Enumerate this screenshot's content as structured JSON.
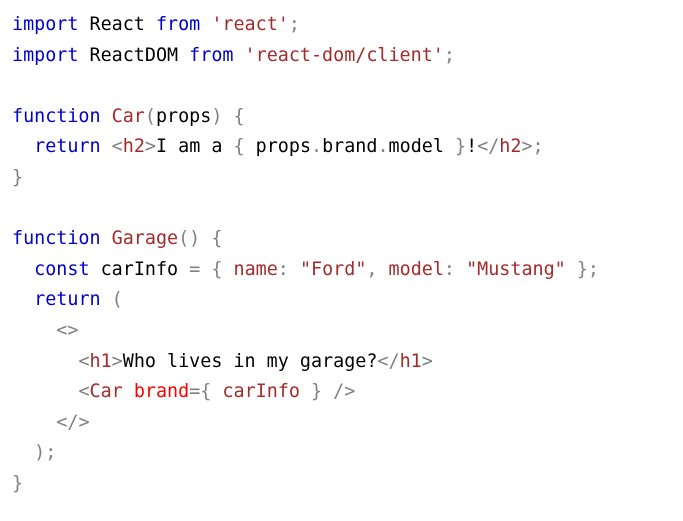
{
  "colors": {
    "keyword": "#0000cd",
    "string": "#a52a2a",
    "function_name": "#a52a2a",
    "punctuation": "#808080",
    "tag": "#a52a2a",
    "attribute": "#ff0000",
    "text": "#000000",
    "background": "#ffffff"
  },
  "code_lines": [
    [
      {
        "t": "import",
        "c": "kw"
      },
      {
        "t": " React ",
        "c": "plain"
      },
      {
        "t": "from",
        "c": "kw"
      },
      {
        "t": " ",
        "c": "plain"
      },
      {
        "t": "'react'",
        "c": "str"
      },
      {
        "t": ";",
        "c": "punct"
      }
    ],
    [
      {
        "t": "import",
        "c": "kw"
      },
      {
        "t": " ReactDOM ",
        "c": "plain"
      },
      {
        "t": "from",
        "c": "kw"
      },
      {
        "t": " ",
        "c": "plain"
      },
      {
        "t": "'react-dom/client'",
        "c": "str"
      },
      {
        "t": ";",
        "c": "punct"
      }
    ],
    [],
    [
      {
        "t": "function",
        "c": "kw"
      },
      {
        "t": " ",
        "c": "plain"
      },
      {
        "t": "Car",
        "c": "fn"
      },
      {
        "t": "(",
        "c": "punct"
      },
      {
        "t": "props",
        "c": "plain"
      },
      {
        "t": ")",
        "c": "punct"
      },
      {
        "t": " ",
        "c": "plain"
      },
      {
        "t": "{",
        "c": "punct"
      }
    ],
    [
      {
        "t": "  ",
        "c": "plain"
      },
      {
        "t": "return",
        "c": "kw"
      },
      {
        "t": " ",
        "c": "plain"
      },
      {
        "t": "<",
        "c": "punct"
      },
      {
        "t": "h2",
        "c": "tag"
      },
      {
        "t": ">",
        "c": "punct"
      },
      {
        "t": "I am a ",
        "c": "plain"
      },
      {
        "t": "{",
        "c": "punct"
      },
      {
        "t": " props",
        "c": "plain"
      },
      {
        "t": ".",
        "c": "punct"
      },
      {
        "t": "brand",
        "c": "plain"
      },
      {
        "t": ".",
        "c": "punct"
      },
      {
        "t": "model ",
        "c": "plain"
      },
      {
        "t": "}",
        "c": "punct"
      },
      {
        "t": "!",
        "c": "plain"
      },
      {
        "t": "</",
        "c": "punct"
      },
      {
        "t": "h2",
        "c": "tag"
      },
      {
        "t": ">",
        "c": "punct"
      },
      {
        "t": ";",
        "c": "punct"
      }
    ],
    [
      {
        "t": "}",
        "c": "punct"
      }
    ],
    [],
    [
      {
        "t": "function",
        "c": "kw"
      },
      {
        "t": " ",
        "c": "plain"
      },
      {
        "t": "Garage",
        "c": "fn"
      },
      {
        "t": "()",
        "c": "punct"
      },
      {
        "t": " ",
        "c": "plain"
      },
      {
        "t": "{",
        "c": "punct"
      }
    ],
    [
      {
        "t": "  ",
        "c": "plain"
      },
      {
        "t": "const",
        "c": "kw"
      },
      {
        "t": " carInfo ",
        "c": "plain"
      },
      {
        "t": "=",
        "c": "punct"
      },
      {
        "t": " ",
        "c": "plain"
      },
      {
        "t": "{",
        "c": "punct"
      },
      {
        "t": " ",
        "c": "plain"
      },
      {
        "t": "name",
        "c": "fn"
      },
      {
        "t": ":",
        "c": "punct"
      },
      {
        "t": " ",
        "c": "plain"
      },
      {
        "t": "\"Ford\"",
        "c": "str"
      },
      {
        "t": ",",
        "c": "punct"
      },
      {
        "t": " ",
        "c": "plain"
      },
      {
        "t": "model",
        "c": "fn"
      },
      {
        "t": ":",
        "c": "punct"
      },
      {
        "t": " ",
        "c": "plain"
      },
      {
        "t": "\"Mustang\"",
        "c": "str"
      },
      {
        "t": " ",
        "c": "plain"
      },
      {
        "t": "};",
        "c": "punct"
      }
    ],
    [
      {
        "t": "  ",
        "c": "plain"
      },
      {
        "t": "return",
        "c": "kw"
      },
      {
        "t": " ",
        "c": "plain"
      },
      {
        "t": "(",
        "c": "punct"
      }
    ],
    [
      {
        "t": "    ",
        "c": "plain"
      },
      {
        "t": "<>",
        "c": "punct"
      }
    ],
    [
      {
        "t": "      ",
        "c": "plain"
      },
      {
        "t": "<",
        "c": "punct"
      },
      {
        "t": "h1",
        "c": "tag"
      },
      {
        "t": ">",
        "c": "punct"
      },
      {
        "t": "Who lives in my garage?",
        "c": "plain"
      },
      {
        "t": "</",
        "c": "punct"
      },
      {
        "t": "h1",
        "c": "tag"
      },
      {
        "t": ">",
        "c": "punct"
      }
    ],
    [
      {
        "t": "      ",
        "c": "plain"
      },
      {
        "t": "<",
        "c": "punct"
      },
      {
        "t": "Car",
        "c": "tag"
      },
      {
        "t": " ",
        "c": "plain"
      },
      {
        "t": "brand",
        "c": "attr"
      },
      {
        "t": "=",
        "c": "punct"
      },
      {
        "t": "{",
        "c": "punct"
      },
      {
        "t": " ",
        "c": "plain"
      },
      {
        "t": "carInfo",
        "c": "fn"
      },
      {
        "t": " ",
        "c": "plain"
      },
      {
        "t": "}",
        "c": "punct"
      },
      {
        "t": " ",
        "c": "plain"
      },
      {
        "t": "/>",
        "c": "punct"
      }
    ],
    [
      {
        "t": "    ",
        "c": "plain"
      },
      {
        "t": "</>",
        "c": "punct"
      }
    ],
    [
      {
        "t": "  ",
        "c": "plain"
      },
      {
        "t": ");",
        "c": "punct"
      }
    ],
    [
      {
        "t": "}",
        "c": "punct"
      }
    ]
  ]
}
